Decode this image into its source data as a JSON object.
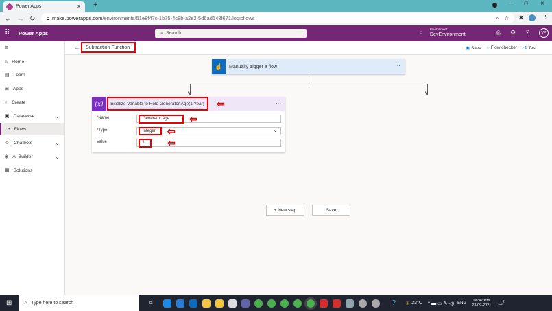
{
  "browser": {
    "tab_title": "Power Apps",
    "url_host": "make.powerapps.com",
    "url_path": "/environments/51e8f47c-1b75-4c8b-a2e2-5d6ad148f671/logicflows"
  },
  "header": {
    "app_name": "Power Apps",
    "search_placeholder": "Search",
    "env_label": "Environment",
    "env_name": "DevEnvironment",
    "avatar": "VP"
  },
  "commandbar": {
    "flow_name": "Subtraction Function",
    "save": "Save",
    "flow_checker": "Flow checker",
    "test": "Test"
  },
  "sidebar": {
    "items": [
      {
        "label": "Home"
      },
      {
        "label": "Learn"
      },
      {
        "label": "Apps"
      },
      {
        "label": "Create"
      },
      {
        "label": "Dataverse",
        "chevron": true
      },
      {
        "label": "Flows",
        "selected": true
      },
      {
        "label": "Chatbots",
        "chevron": true
      },
      {
        "label": "AI Builder",
        "chevron": true
      },
      {
        "label": "Solutions"
      }
    ]
  },
  "trigger": {
    "title": "Manually trigger a flow",
    "more": "···"
  },
  "action": {
    "icon": "{x}",
    "title": "Initialize Variable to Hold Generator Age(1 Year)",
    "more": "···",
    "fields": [
      {
        "label": "Name",
        "required": "*",
        "value": "Generator Age"
      },
      {
        "label": "Type",
        "required": "*",
        "value": "Integer"
      },
      {
        "label": "Value",
        "value": "1"
      }
    ]
  },
  "buttons": {
    "new_step": "+ New step",
    "save": "Save"
  },
  "taskbar": {
    "search_placeholder": "Type here to search",
    "weather": "23°C",
    "lang": "ENG",
    "time": "08:47 PM",
    "date": "23-09-2021",
    "notifications": "2"
  },
  "colors": {
    "brand": "#742774",
    "annotation": "#ee0000"
  }
}
